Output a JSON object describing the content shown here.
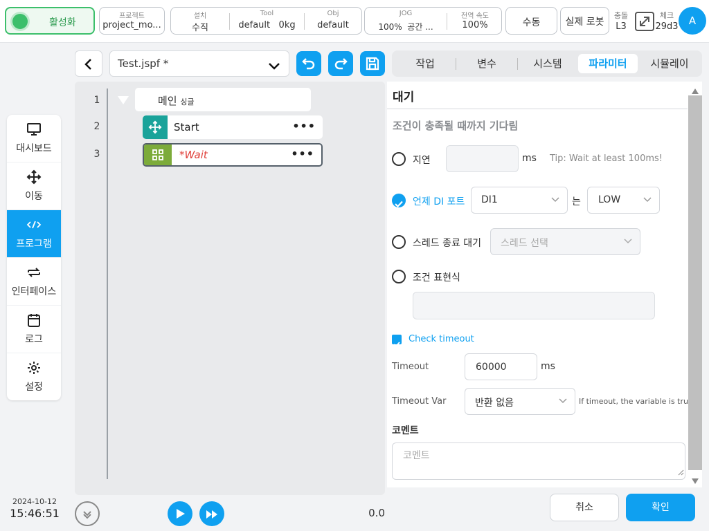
{
  "topbar": {
    "activate_label": "활성화",
    "project_caption": "프로젝트",
    "project_value": "project_mo...",
    "install_caption": "설치",
    "install_value": "수직",
    "tool_caption": "Tool",
    "tool_value": "default",
    "tool_weight": "0kg",
    "obj_caption": "Obj",
    "obj_value": "default",
    "jog_caption": "JOG",
    "jog_percent": "100%",
    "jog_space": "공간 ...",
    "speed_caption": "전역 속도",
    "speed_value": "100%",
    "mode_button": "수동",
    "robot_button": "실제 로봇",
    "collision_caption": "충돌",
    "collision_value": "L3",
    "check_caption": "체크",
    "check_value": "29d3",
    "avatar_letter": "A"
  },
  "sidebar": {
    "items": [
      {
        "label": "대시보드",
        "icon": "monitor-icon"
      },
      {
        "label": "이동",
        "icon": "move-icon"
      },
      {
        "label": "프로그램",
        "icon": "code-icon"
      },
      {
        "label": "인터페이스",
        "icon": "swap-icon"
      },
      {
        "label": "로그",
        "icon": "calendar-icon"
      },
      {
        "label": "설정",
        "icon": "gear-icon"
      }
    ],
    "active_index": 2
  },
  "clock": {
    "date": "2024-10-12",
    "time": "15:46:51"
  },
  "file": {
    "name": "Test.jspf *"
  },
  "program": {
    "lines": [
      "1",
      "2",
      "3"
    ],
    "main_label": "메인",
    "main_sub": "싱글",
    "start_label": "Start",
    "wait_label": "*Wait"
  },
  "player": {
    "progress_value": "0.0"
  },
  "tabs": [
    "작업",
    "변수",
    "시스템",
    "파라미터",
    "시뮬레이"
  ],
  "active_tab": "파라미터",
  "panel": {
    "title": "대기",
    "subtitle": "조건이 충족될 때까지 기다림",
    "delay_label": "지연",
    "delay_unit": "ms",
    "delay_tip": "Tip: Wait at least 100ms!",
    "di_label": "언제 DI 포트",
    "di_port": "DI1",
    "di_is": "는",
    "di_level": "LOW",
    "thread_label": "스레드 종료 대기",
    "thread_placeholder": "스레드 선택",
    "expr_label": "조건 표현식",
    "check_timeout_label": "Check timeout",
    "timeout_label": "Timeout",
    "timeout_value": "60000",
    "timeout_unit": "ms",
    "timeout_var_label": "Timeout Var",
    "timeout_var_value": "반환 없음",
    "timeout_note": "If timeout, the variable is true",
    "comment_label": "코멘트",
    "comment_placeholder": "코멘트",
    "cancel_button": "취소",
    "ok_button": "확인"
  },
  "colors": {
    "accent": "#0fa0f0",
    "node_move": "#1aa39a",
    "node_wait": "#7cab3a",
    "status_green": "#3cbf6b",
    "wait_text": "#e0413b"
  }
}
